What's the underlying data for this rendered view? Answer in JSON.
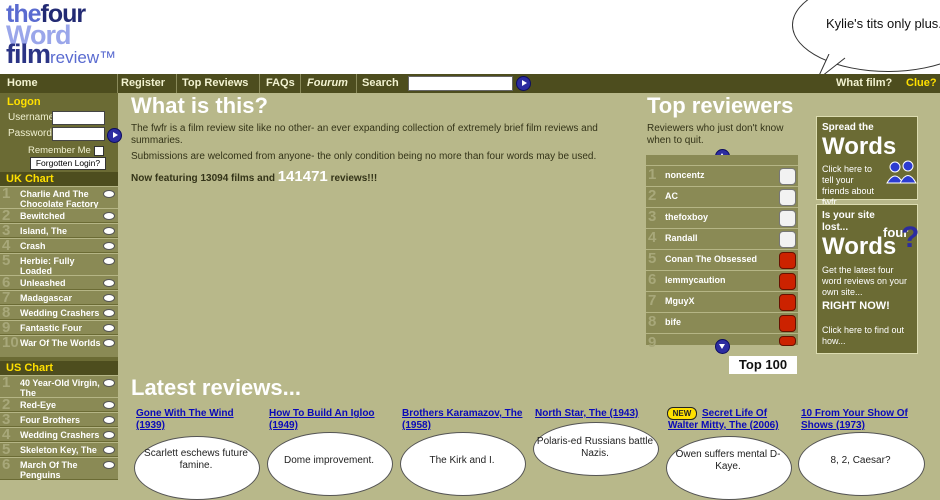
{
  "logo": {
    "the": "the",
    "four": "four",
    "word": "Word",
    "film": "film",
    "review": "review™"
  },
  "speech": {
    "text": "Kylie's tits only plus."
  },
  "nav": {
    "home": "Home",
    "register": "Register",
    "top_reviews": "Top Reviews",
    "faqs": "FAQs",
    "forum": "Fourum",
    "search": "Search",
    "what_film": "What film?",
    "clue": "Clue?"
  },
  "login": {
    "title": "Logon",
    "username": "Username",
    "password": "Password",
    "remember": "Remember Me",
    "forgot": "Forgotten Login?"
  },
  "uk_chart": {
    "title": "UK Chart",
    "items": [
      {
        "num": "1",
        "title": "Charlie And The Chocolate Factory"
      },
      {
        "num": "2",
        "title": "Bewitched"
      },
      {
        "num": "3",
        "title": "Island, The"
      },
      {
        "num": "4",
        "title": "Crash"
      },
      {
        "num": "5",
        "title": "Herbie: Fully Loaded"
      },
      {
        "num": "6",
        "title": "Unleashed"
      },
      {
        "num": "7",
        "title": "Madagascar"
      },
      {
        "num": "8",
        "title": "Wedding Crashers"
      },
      {
        "num": "9",
        "title": "Fantastic Four"
      },
      {
        "num": "10",
        "title": "War Of The Worlds"
      }
    ]
  },
  "us_chart": {
    "title": "US Chart",
    "items": [
      {
        "num": "1",
        "title": "40 Year-Old Virgin, The"
      },
      {
        "num": "2",
        "title": "Red-Eye"
      },
      {
        "num": "3",
        "title": "Four Brothers"
      },
      {
        "num": "4",
        "title": "Wedding Crashers"
      },
      {
        "num": "5",
        "title": "Skeleton Key, The"
      },
      {
        "num": "6",
        "title": "March Of The Penguins"
      }
    ]
  },
  "main": {
    "heading": "What is this?",
    "intro": "The fwfr is a film review site like no other- an ever expanding collection of extremely brief film reviews and summaries.",
    "submissions": "Submissions are welcomed from anyone- the only condition being no more than four words may be used.",
    "featuring_prefix": "Now featuring 13094 films and",
    "review_count": "141471",
    "featuring_suffix": "reviews!!!"
  },
  "top_reviewers": {
    "heading": "Top reviewers",
    "sub": "Reviewers who just don't know when to quit.",
    "items": [
      {
        "num": "1",
        "name": "noncentz",
        "badge": "white"
      },
      {
        "num": "2",
        "name": "AC",
        "badge": "white"
      },
      {
        "num": "3",
        "name": "thefoxboy",
        "badge": "white"
      },
      {
        "num": "4",
        "name": "Randall",
        "badge": "white"
      },
      {
        "num": "5",
        "name": "Conan The Obsessed",
        "badge": "red"
      },
      {
        "num": "6",
        "name": "lemmycaution",
        "badge": "red"
      },
      {
        "num": "7",
        "name": "MguyX",
        "badge": "red"
      },
      {
        "num": "8",
        "name": "bife",
        "badge": "red"
      },
      {
        "num": "9",
        "name": "",
        "badge": "red"
      }
    ],
    "top100": "Top 100"
  },
  "promo1": {
    "small": "Spread the",
    "big": "Words",
    "body": "Click here to tell your friends about fwfr..."
  },
  "promo2": {
    "small": "Is your site lost...",
    "four": "four",
    "big": "Words",
    "body": "Get the latest four word reviews on your own site...",
    "now": "RIGHT NOW!",
    "cta": "Click here to find out how..."
  },
  "latest": {
    "heading": "Latest reviews...",
    "new_badge": "NEW",
    "items": [
      {
        "title": "Gone With The Wind (1939)",
        "review": "Scarlett eschews future famine."
      },
      {
        "title": "How To Build An Igloo (1949)",
        "review": "Dome improvement."
      },
      {
        "title": "Brothers Karamazov, The (1958)",
        "review": "The Kirk and I."
      },
      {
        "title": "North Star, The (1943)",
        "review": "Polaris-ed Russians battle Nazis."
      },
      {
        "title": "Secret Life Of Walter Mitty, The (2006)",
        "review": "Owen suffers mental D-Kaye."
      },
      {
        "title": "10 From Your Show Of Shows (1973)",
        "review": "8, 2, Caesar?"
      }
    ]
  },
  "colors": {
    "page_bg": "#b8b88a",
    "nav_bg": "#4d4d1e",
    "sidebar_bg": "#6b6b34",
    "accent_yellow": "#ffe000",
    "link_blue": "#0a0ab8"
  }
}
